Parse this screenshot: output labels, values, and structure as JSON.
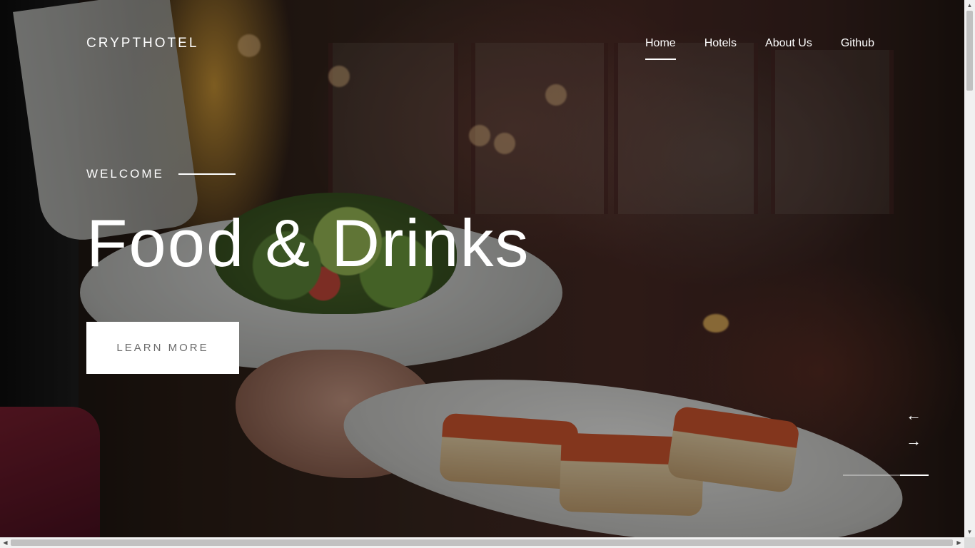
{
  "brand": {
    "logo": "CRYPTHOTEL"
  },
  "nav": {
    "items": [
      {
        "label": "Home",
        "active": true
      },
      {
        "label": "Hotels",
        "active": false
      },
      {
        "label": "About Us",
        "active": false
      },
      {
        "label": "Github",
        "active": false
      }
    ]
  },
  "hero": {
    "eyebrow": "WELCOME",
    "title": "Food & Drinks",
    "cta_label": "LEARN MORE",
    "prev_arrow": "←",
    "next_arrow": "→",
    "slide_progress": 0.33
  },
  "icons": {
    "prev": "arrow-left-icon",
    "next": "arrow-right-icon"
  },
  "colors": {
    "text": "#ffffff",
    "button_bg": "#ffffff",
    "button_text": "#6b6b6b"
  }
}
